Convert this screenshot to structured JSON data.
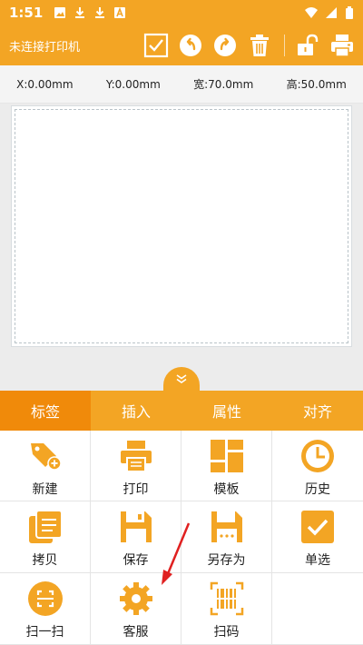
{
  "status_bar": {
    "time": "1:51"
  },
  "app_bar": {
    "title": "未连接打印机"
  },
  "toolbar_icons": [
    "checkbox-icon",
    "undo-icon",
    "redo-icon",
    "trash-icon",
    "unlock-icon",
    "printer-icon"
  ],
  "coords": {
    "x": "X:0.00mm",
    "y": "Y:0.00mm",
    "width": "宽:70.0mm",
    "height": "高:50.0mm"
  },
  "tabs": [
    {
      "label": "标签",
      "active": true
    },
    {
      "label": "插入",
      "active": false
    },
    {
      "label": "属性",
      "active": false
    },
    {
      "label": "对齐",
      "active": false
    }
  ],
  "grid": [
    {
      "label": "新建",
      "icon": "new-tag-icon"
    },
    {
      "label": "打印",
      "icon": "print-icon"
    },
    {
      "label": "模板",
      "icon": "template-icon"
    },
    {
      "label": "历史",
      "icon": "history-icon"
    },
    {
      "label": "拷贝",
      "icon": "copy-icon"
    },
    {
      "label": "保存",
      "icon": "save-icon"
    },
    {
      "label": "另存为",
      "icon": "save-as-icon"
    },
    {
      "label": "单选",
      "icon": "single-select-icon"
    },
    {
      "label": "扫一扫",
      "icon": "scan-icon"
    },
    {
      "label": "客服",
      "icon": "settings-gear-icon"
    },
    {
      "label": "扫码",
      "icon": "barcode-scan-icon"
    }
  ],
  "colors": {
    "accent": "#f3a524",
    "accent_dark": "#f08a0a",
    "annotation": "#e02020"
  }
}
